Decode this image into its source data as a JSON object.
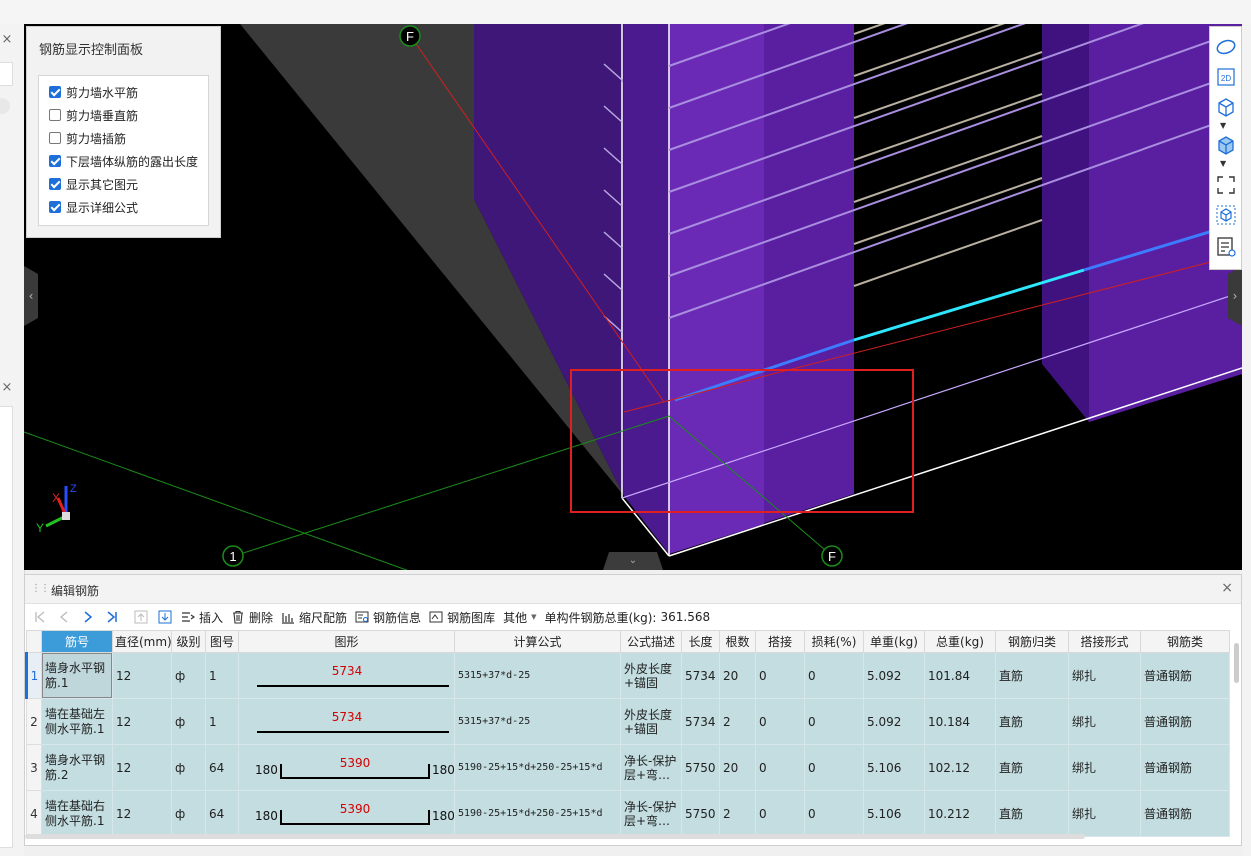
{
  "control_panel": {
    "title": "钢筋显示控制面板",
    "options": [
      {
        "label": "剪力墙水平筋",
        "checked": true
      },
      {
        "label": "剪力墙垂直筋",
        "checked": false
      },
      {
        "label": "剪力墙插筋",
        "checked": false
      },
      {
        "label": "下层墙体纵筋的露出长度",
        "checked": true
      },
      {
        "label": "显示其它图元",
        "checked": true
      },
      {
        "label": "显示详细公式",
        "checked": true
      }
    ]
  },
  "viewport": {
    "axis_markers": [
      "F",
      "1",
      "F"
    ],
    "gizmo": {
      "x": "X",
      "y": "Y",
      "z": "Z"
    },
    "view_tools": [
      "orbit-icon",
      "2d-view-icon",
      "3d-box-icon",
      "3d-solid-icon",
      "fit-view-icon",
      "isometric-icon",
      "view-list-icon"
    ],
    "view_2d_label": "2D"
  },
  "rebar_panel": {
    "title": "编辑钢筋",
    "toolbar": {
      "insert": "插入",
      "delete": "删除",
      "scale_rebar": "缩尺配筋",
      "rebar_info": "钢筋信息",
      "rebar_library": "钢筋图库",
      "other": "其他",
      "total_weight_label": "单构件钢筋总重(kg):",
      "total_weight_value": "361.568"
    },
    "columns": [
      "筋号",
      "直径(mm)",
      "级别",
      "图号",
      "图形",
      "计算公式",
      "公式描述",
      "长度",
      "根数",
      "搭接",
      "损耗(%)",
      "单重(kg)",
      "总重(kg)",
      "钢筋归类",
      "搭接形式",
      "钢筋类"
    ],
    "rows": [
      {
        "row": "1",
        "name": "墙身水平钢筋.1",
        "dia": "12",
        "grade": "ф",
        "fig": "1",
        "shape_len": "5734",
        "shape_left": "",
        "shape_right": "",
        "formula": "5315+37*d-25",
        "desc": "外皮长度+锚固",
        "length": "5734",
        "count": "20",
        "lap": "0",
        "loss": "0",
        "unit_w": "5.092",
        "total_w": "101.84",
        "category": "直筋",
        "lap_type": "绑扎",
        "type": "普通钢筋"
      },
      {
        "row": "2",
        "name": "墙在基础左侧水平筋.1",
        "dia": "12",
        "grade": "ф",
        "fig": "1",
        "shape_len": "5734",
        "shape_left": "",
        "shape_right": "",
        "formula": "5315+37*d-25",
        "desc": "外皮长度+锚固",
        "length": "5734",
        "count": "2",
        "lap": "0",
        "loss": "0",
        "unit_w": "5.092",
        "total_w": "10.184",
        "category": "直筋",
        "lap_type": "绑扎",
        "type": "普通钢筋"
      },
      {
        "row": "3",
        "name": "墙身水平钢筋.2",
        "dia": "12",
        "grade": "ф",
        "fig": "64",
        "shape_len": "5390",
        "shape_left": "180",
        "shape_right": "180",
        "formula": "5190-25+15*d+250-25+15*d",
        "desc": "净长-保护层+弯…",
        "length": "5750",
        "count": "20",
        "lap": "0",
        "loss": "0",
        "unit_w": "5.106",
        "total_w": "102.12",
        "category": "直筋",
        "lap_type": "绑扎",
        "type": "普通钢筋"
      },
      {
        "row": "4",
        "name": "墙在基础右侧水平筋.1",
        "dia": "12",
        "grade": "ф",
        "fig": "64",
        "shape_len": "5390",
        "shape_left": "180",
        "shape_right": "180",
        "formula": "5190-25+15*d+250-25+15*d",
        "desc": "净长-保护层+弯…",
        "length": "5750",
        "count": "2",
        "lap": "0",
        "loss": "0",
        "unit_w": "5.106",
        "total_w": "10.212",
        "category": "直筋",
        "lap_type": "绑扎",
        "type": "普通钢筋"
      }
    ]
  },
  "colors": {
    "viewport_bg": "#000000",
    "wall_purple": "#5a1fa0",
    "highlight_box": "#e02020",
    "row_bg": "#c3dde0",
    "header_selected": "#3c9bd9",
    "shape_len_text": "#d40000"
  }
}
